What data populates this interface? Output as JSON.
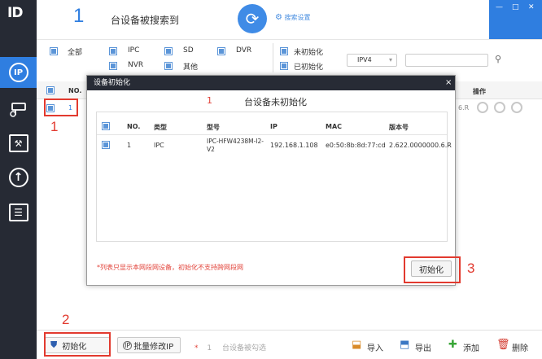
{
  "app": {
    "logo": "ID"
  },
  "header": {
    "device_count": "1",
    "found_label": "台设备被搜索到",
    "refresh_glyph": "⟳",
    "search_settings": "搜索设置"
  },
  "window_controls": {
    "minimize": "—",
    "maximize": "□",
    "close": "✕"
  },
  "filters": {
    "all": "全部",
    "ipc": "IPC",
    "sd": "SD",
    "dvr": "DVR",
    "nvr": "NVR",
    "other": "其他",
    "uninitialized": "未初始化",
    "initialized": "已初始化",
    "ip_version": "IPV4",
    "dropdown_glyph": "▾",
    "search_glyph": "⚲"
  },
  "main_table": {
    "col_no": "NO.",
    "col_ops": "操作",
    "row1_no": "1",
    "row1_version_fragment": "6.R"
  },
  "dialog": {
    "title": "设备初始化",
    "close": "×",
    "count": "1",
    "uninit_label": "台设备未初始化",
    "columns": {
      "no": "NO.",
      "type": "类型",
      "model": "型号",
      "ip": "IP",
      "mac": "MAC",
      "version": "版本号"
    },
    "rows": [
      {
        "no": "1",
        "type": "IPC",
        "model_line1": "IPC-HFW4238M-I2-",
        "model_line2": "V2",
        "ip": "192.168.1.108",
        "mac": "e0:50:8b:8d:77:cd",
        "version": "2.622.0000000.6.R"
      }
    ],
    "note": "*列表只显示本网段网设备，初始化不支持跨网段网",
    "init_button": "初始化"
  },
  "bottom": {
    "init_button": "初始化",
    "batch_ip_button": "批量修改IP",
    "selected_star": "*",
    "selected_count": "1",
    "selected_label": "台设备被勾选",
    "import": "导入",
    "export": "导出",
    "add": "添加",
    "delete": "删除"
  },
  "annotations": {
    "step1": "1",
    "step2": "2",
    "step3": "3"
  },
  "colors": {
    "accent": "#2f7ee0",
    "sidebar": "#262a34",
    "annotation": "#e23a2f"
  },
  "icons": {
    "sidebar": [
      "ip-device-icon",
      "camera-config-icon",
      "system-tools-icon",
      "upgrade-icon",
      "document-icon"
    ]
  }
}
